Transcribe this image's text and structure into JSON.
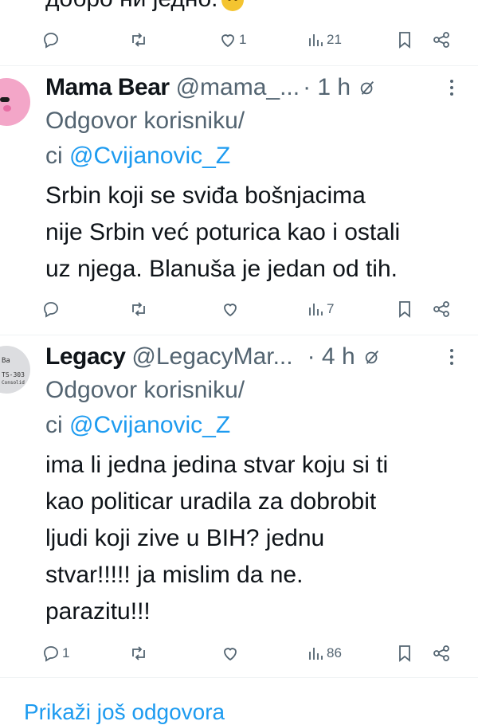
{
  "previous_tweet": {
    "cut_text": "добро ни једно.",
    "emoji": "angry-face-emoji",
    "actions": {
      "replies": "",
      "reposts": "",
      "likes": "1",
      "views": "21"
    }
  },
  "tweets": [
    {
      "name": "Mama Bear",
      "handle": "@mama_...",
      "time": "· 1 h",
      "reply_prefix": "Odgovor korisniku/",
      "reply_prefix2": "ci ",
      "reply_mention": "@Cvijanovic_Z",
      "lines": [
        "Srbin koji se sviđa bošnjacima",
        "nije Srbin već poturica kao i ostali",
        "uz njega. Blanuša je jedan od tih."
      ],
      "actions": {
        "replies": "",
        "reposts": "",
        "likes": "",
        "views": "7"
      }
    },
    {
      "name": "Legacy",
      "handle": "@LegacyMar...",
      "time": "· 4 h",
      "reply_prefix": "Odgovor korisniku/",
      "reply_prefix2": "ci ",
      "reply_mention": "@Cvijanovic_Z",
      "lines": [
        "ima li jedna jedina stvar koju si ti",
        "kao politicar uradila za dobrobit",
        "ljudi koji zive u BIH? jednu",
        "stvar!!!!! ja mislim da ne.",
        "parazitu!!!"
      ],
      "avatar_text": [
        "Ba",
        "TS-303",
        "Consolid"
      ],
      "actions": {
        "replies": "1",
        "reposts": "",
        "likes": "",
        "views": "86"
      }
    }
  ],
  "bottom_link": "Prikaži još odgovora",
  "colors": {
    "accent": "#1d9bf0",
    "secondary_text": "#536471",
    "divider": "#eff3f4"
  }
}
